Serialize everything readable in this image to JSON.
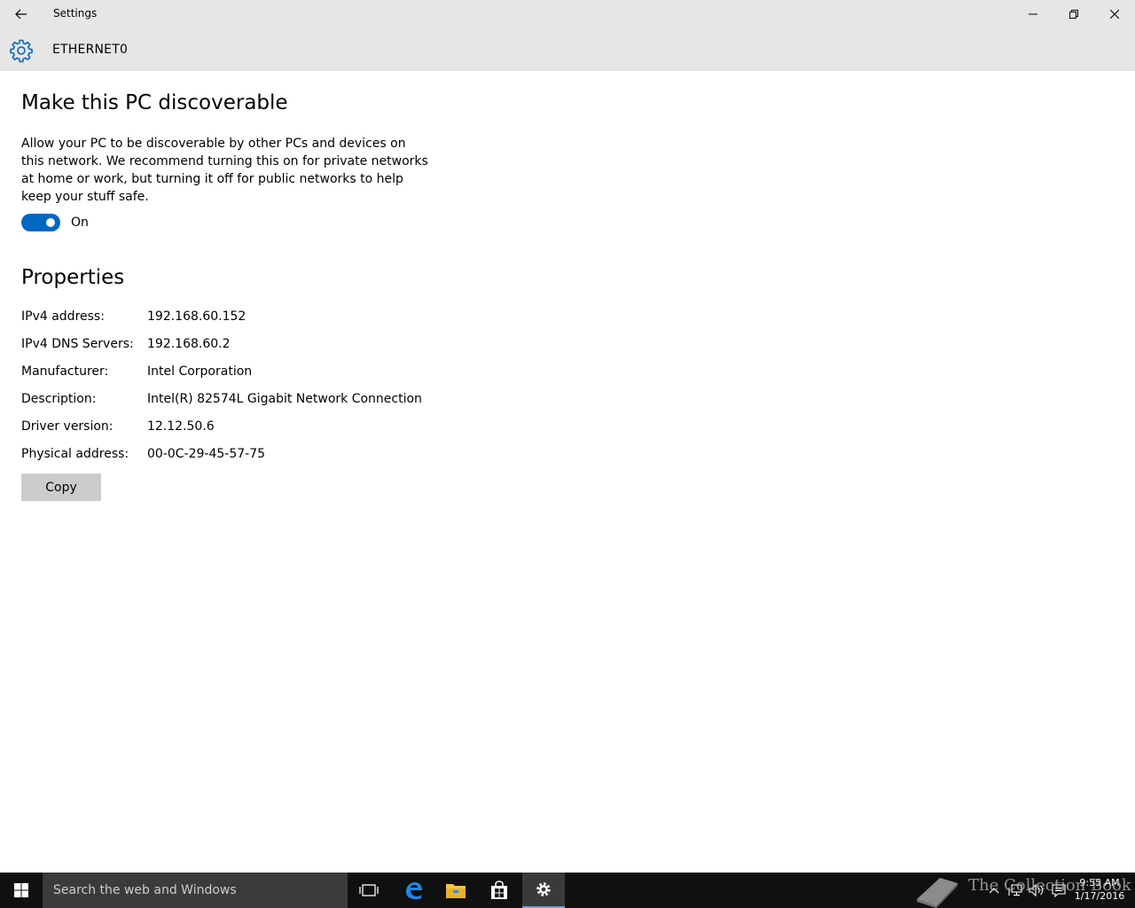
{
  "window": {
    "title": "Settings",
    "back_icon": "arrow-left-icon",
    "controls": [
      "minimize-icon",
      "restore-icon",
      "close-icon"
    ]
  },
  "header": {
    "title": "ETHERNET0",
    "icon": "gear-icon"
  },
  "discoverable": {
    "heading": "Make this PC discoverable",
    "description": "Allow your PC to be discoverable by other PCs and devices on this network. We recommend turning this on for private networks at home or work, but turning it off for public networks to help keep your stuff safe.",
    "toggle_state": "On",
    "toggle_on": true
  },
  "properties": {
    "heading": "Properties",
    "rows": [
      {
        "label": "IPv4 address:",
        "value": "192.168.60.152"
      },
      {
        "label": "IPv4 DNS Servers:",
        "value": "192.168.60.2"
      },
      {
        "label": "Manufacturer:",
        "value": "Intel Corporation"
      },
      {
        "label": "Description:",
        "value": "Intel(R) 82574L Gigabit Network Connection"
      },
      {
        "label": "Driver version:",
        "value": "12.12.50.6"
      },
      {
        "label": "Physical address:",
        "value": "00-0C-29-45-57-75"
      }
    ],
    "copy_label": "Copy"
  },
  "taskbar": {
    "search_placeholder": "Search the web and Windows",
    "apps": [
      "task-view-icon",
      "edge-icon",
      "file-explorer-icon",
      "store-icon",
      "settings-gear-icon"
    ],
    "tray_icons": [
      "chevron-up-icon",
      "network-icon",
      "volume-icon",
      "action-center-icon"
    ],
    "time": "9:55 AM",
    "date": "1/17/2016"
  },
  "watermark": {
    "text": "The Collection Book",
    "icon": "book-icon"
  },
  "colors": {
    "accent": "#0067c0",
    "chrome": "#e6e6e6",
    "taskbar": "#101010",
    "search_box": "#3b3b3b",
    "button": "#cccccc"
  }
}
